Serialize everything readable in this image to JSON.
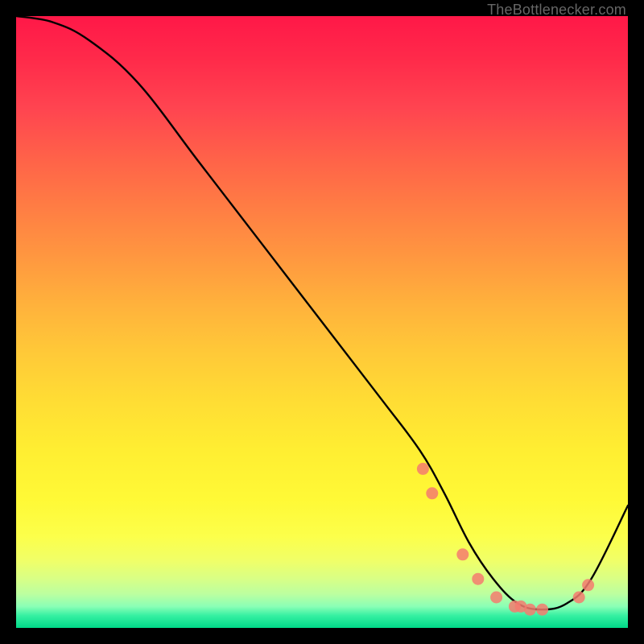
{
  "watermark": "TheBottlenecker.com",
  "chart_data": {
    "type": "line",
    "title": "",
    "xlabel": "",
    "ylabel": "",
    "xlim": [
      0,
      100
    ],
    "ylim": [
      0,
      100
    ],
    "series": [
      {
        "name": "bottleneck-curve",
        "x": [
          0,
          6,
          12,
          20,
          30,
          40,
          50,
          60,
          66,
          70,
          74,
          78,
          82,
          86,
          90,
          94,
          100
        ],
        "y": [
          100,
          99,
          96,
          89,
          76,
          63,
          50,
          37,
          29,
          22,
          14,
          8,
          4,
          3,
          4,
          8,
          20
        ]
      }
    ],
    "markers": {
      "name": "trough-markers",
      "x": [
        66.5,
        68.0,
        73.0,
        75.5,
        78.5,
        81.5,
        82.5,
        84.0,
        86.0,
        92.0,
        93.5
      ],
      "y": [
        26,
        22,
        12,
        8,
        5,
        3.5,
        3.5,
        3,
        3,
        5,
        7
      ]
    },
    "gradient_stops": [
      {
        "pct": 0,
        "color": "#ff1848"
      },
      {
        "pct": 50,
        "color": "#ffd038"
      },
      {
        "pct": 85,
        "color": "#fdff46"
      },
      {
        "pct": 100,
        "color": "#00d988"
      }
    ]
  }
}
